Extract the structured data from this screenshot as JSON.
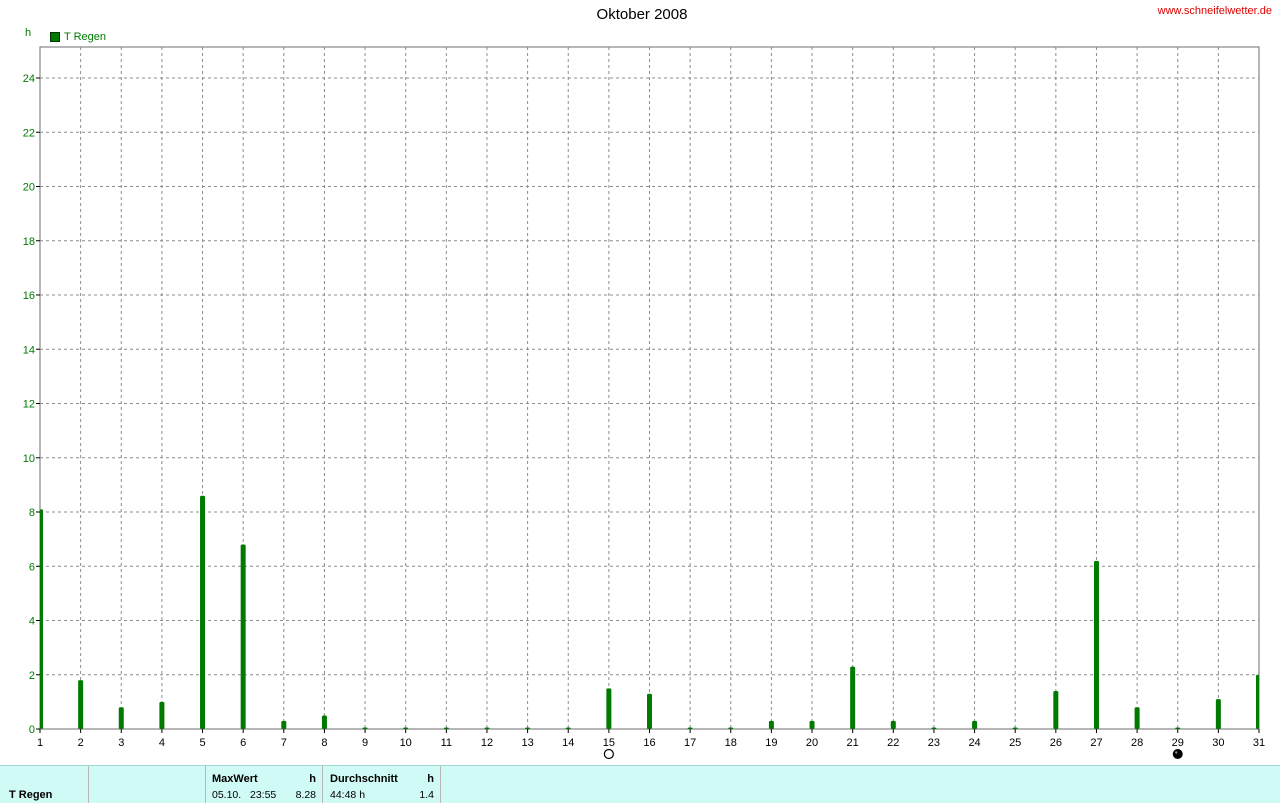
{
  "chart_data": {
    "type": "bar",
    "title": "Oktober 2008",
    "ylabel": "h",
    "xlabel": "",
    "ylim": [
      0,
      25
    ],
    "yticks": [
      "0",
      "2",
      "4",
      "6",
      "8",
      "10",
      "12",
      "14",
      "16",
      "18",
      "20",
      "22",
      "24"
    ],
    "ytick_values": [
      0,
      2,
      4,
      6,
      8,
      10,
      12,
      14,
      16,
      18,
      20,
      22,
      24
    ],
    "xlim": [
      1,
      31
    ],
    "grid": true,
    "legend_position": "top-left",
    "categories": [
      "1",
      "2",
      "3",
      "4",
      "5",
      "6",
      "7",
      "8",
      "9",
      "10",
      "11",
      "12",
      "13",
      "14",
      "15",
      "16",
      "17",
      "18",
      "19",
      "20",
      "21",
      "22",
      "23",
      "24",
      "25",
      "26",
      "27",
      "28",
      "29",
      "30",
      "31"
    ],
    "series": [
      {
        "name": "T Regen",
        "color": "#007a00",
        "values": [
          8.1,
          1.8,
          0.8,
          1.0,
          8.6,
          6.8,
          0.3,
          0.5,
          0.0,
          0.0,
          0.0,
          0.0,
          0.0,
          0.0,
          1.5,
          1.3,
          0.0,
          0.0,
          0.3,
          0.3,
          2.3,
          0.3,
          0.0,
          0.3,
          0.0,
          1.4,
          6.2,
          0.8,
          0.0,
          1.1,
          2.0
        ]
      }
    ],
    "moon_phases": [
      {
        "day": 15,
        "phase": "full",
        "icon": "full-moon-icon"
      },
      {
        "day": 29,
        "phase": "new",
        "icon": "new-moon-icon"
      }
    ]
  },
  "header": {
    "site": "www.schneifelwetter.de"
  },
  "stats": {
    "series_label": "T Regen",
    "max_header": "MaxWert",
    "max_unit": "h",
    "max_date": "05.10.",
    "max_time": "23:55",
    "max_value": "8.28",
    "avg_header": "Durchschnitt",
    "avg_unit": "h",
    "avg_total": "44:48 h",
    "avg_value": "1.4"
  },
  "colors": {
    "series": "#007a00",
    "grid": "#8c8c8c",
    "panel_bg": "#cffaf5",
    "site_link": "#e00000"
  }
}
